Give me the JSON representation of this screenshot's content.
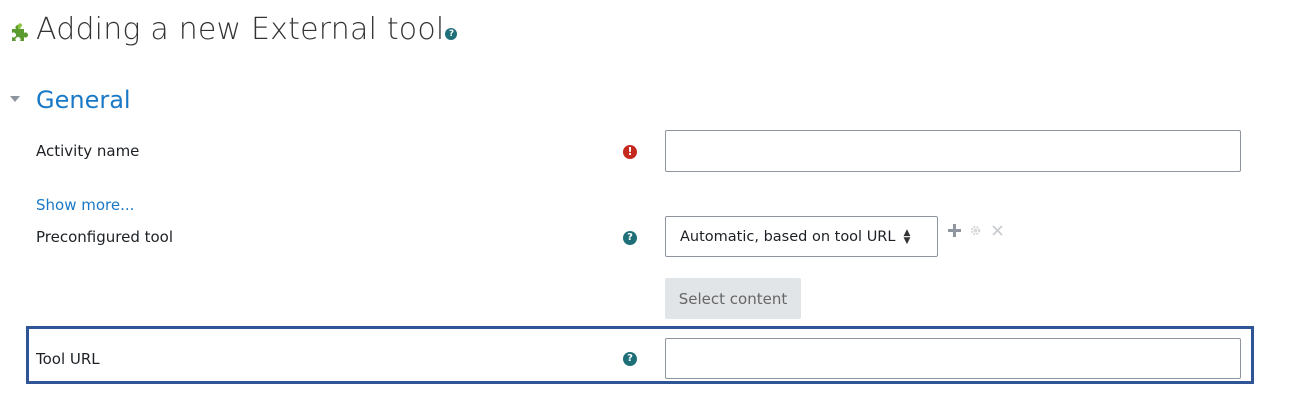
{
  "page": {
    "title": "Adding a new External tool",
    "title_help_icon": "help-icon",
    "plugin_icon": "puzzle-piece-icon"
  },
  "section": {
    "title": "General",
    "toggle_icon": "caret-down-icon"
  },
  "form": {
    "activity_name": {
      "label": "Activity name",
      "value": "",
      "status_icon": "required-error-icon"
    },
    "show_more": "Show more...",
    "preconfigured_tool": {
      "label": "Preconfigured tool",
      "selected": "Automatic, based on tool URL",
      "help_icon": "help-icon",
      "actions": [
        "add-icon",
        "gear-icon",
        "close-icon"
      ]
    },
    "select_content_button": "Select content",
    "tool_url": {
      "label": "Tool URL",
      "value": "",
      "help_icon": "help-icon"
    }
  },
  "colors": {
    "link_blue": "#1a79c7",
    "required_red": "#c52a1f",
    "help_teal": "#1f6f78",
    "highlight_border": "#2f5597",
    "plugin_green": "#5a9a2f"
  }
}
